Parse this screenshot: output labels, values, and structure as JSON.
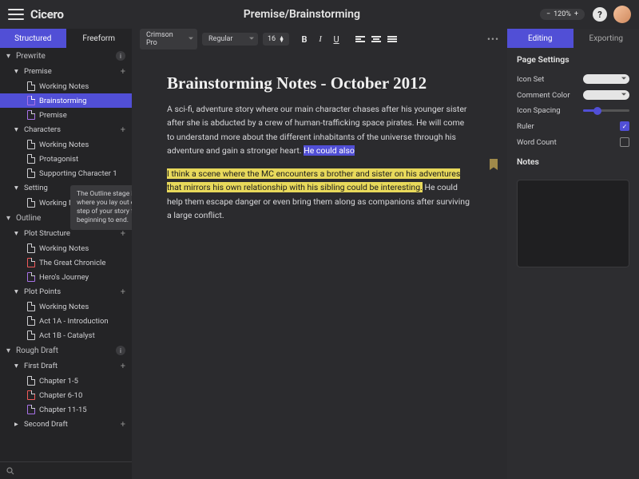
{
  "header": {
    "logo": "Cicero",
    "breadcrumb": "Premise/Brainstorming",
    "zoom": "120%"
  },
  "sidebar": {
    "tabs": [
      "Structured",
      "Freeform"
    ],
    "activeTab": 0,
    "tooltip": "The Outline stage is where you lay out each step of your story from beginning to end.",
    "sections": [
      {
        "name": "Prewrite",
        "badge": "i",
        "groups": [
          {
            "name": "Premise",
            "items": [
              {
                "label": "Working Notes"
              },
              {
                "label": "Brainstorming",
                "selected": true,
                "color": "purple"
              },
              {
                "label": "Premise",
                "color": "purple"
              }
            ]
          },
          {
            "name": "Characters",
            "items": [
              {
                "label": "Working Notes"
              },
              {
                "label": "Protagonist"
              },
              {
                "label": "Supporting Character 1"
              }
            ]
          },
          {
            "name": "Setting",
            "items": [
              {
                "label": "Working Not"
              }
            ]
          }
        ]
      },
      {
        "name": "Outline",
        "badge": "i",
        "groups": [
          {
            "name": "Plot Structure",
            "items": [
              {
                "label": "Working Notes"
              },
              {
                "label": "The Great Chronicle",
                "color": "red"
              },
              {
                "label": "Hero's Journey",
                "color": "purple"
              }
            ]
          },
          {
            "name": "Plot Points",
            "items": [
              {
                "label": "Working Notes"
              },
              {
                "label": "Act 1A - Introduction"
              },
              {
                "label": "Act 1B - Catalyst"
              }
            ]
          }
        ]
      },
      {
        "name": "Rough Draft",
        "badge": "i",
        "groups": [
          {
            "name": "First Draft",
            "items": [
              {
                "label": "Chapter 1-5"
              },
              {
                "label": "Chapter 6-10",
                "color": "red"
              },
              {
                "label": "Chapter 11-15",
                "color": "purple"
              }
            ]
          },
          {
            "name": "Second Draft",
            "collapsed": true
          }
        ]
      }
    ]
  },
  "toolbar": {
    "font": "Crimson Pro",
    "weight": "Regular",
    "size": "16"
  },
  "doc": {
    "title": "Brainstorming Notes - October 2012",
    "p1a": "A sci-fi, adventure story where our main character chases after his younger sister after she is abducted by a crew of human-trafficking space pirates. He will come to understand more about the different inhabitants of the universe through his adventure and gain a stronger heart. ",
    "p1sel": "He could also",
    "p2hl": "I think a scene where the MC encounters a brother and sister on his adventures that mirrors his own relationship with his sibling could be interesting.",
    "p2rest": " He could help them escape danger or even bring them along as companions after surviving a large conflict."
  },
  "panel": {
    "tabs": [
      "Editing",
      "Exporting"
    ],
    "activeTab": 0,
    "section1": "Page Settings",
    "rows": [
      {
        "label": "Icon Set",
        "ctrl": "pill"
      },
      {
        "label": "Comment Color",
        "ctrl": "pill"
      },
      {
        "label": "Icon Spacing",
        "ctrl": "slider"
      },
      {
        "label": "Ruler",
        "ctrl": "check",
        "on": true
      },
      {
        "label": "Word Count",
        "ctrl": "check",
        "on": false
      }
    ],
    "section2": "Notes"
  }
}
